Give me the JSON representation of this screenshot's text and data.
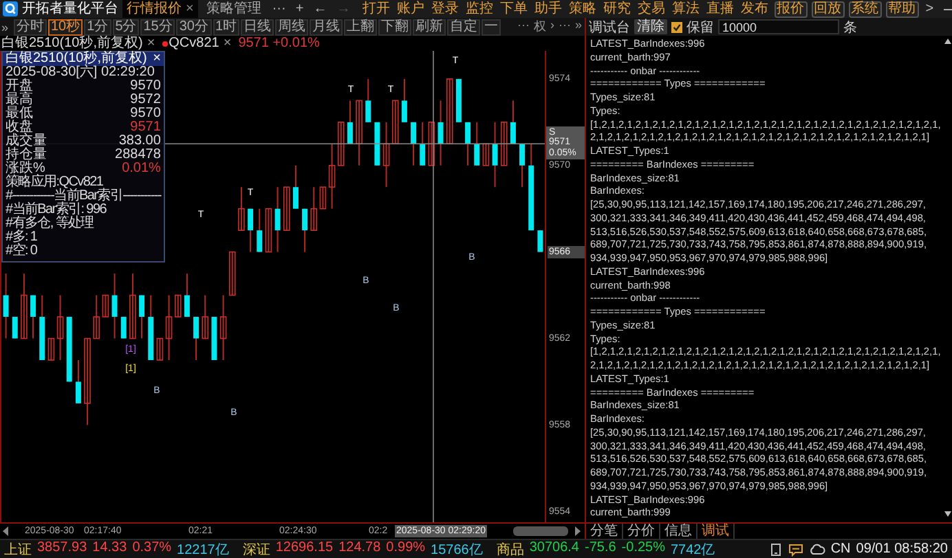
{
  "title_bar": {
    "app_name": "开拓者量化平台",
    "tabs": [
      {
        "label": "行情报价",
        "selected": true,
        "close_label": "×"
      },
      {
        "label": "策略管理",
        "selected": false
      }
    ],
    "tab_controls": [
      {
        "label": "···",
        "disabled": false
      },
      {
        "label": "+",
        "disabled": false
      },
      {
        "label": "←",
        "disabled": false
      },
      {
        "label": "→",
        "disabled": true
      }
    ],
    "menu": [
      "打开",
      "账户",
      "登录",
      "监控",
      "下单",
      "助手",
      "策略",
      "研究",
      "交易",
      "算法",
      "直播",
      "发布"
    ],
    "menu_buttons": [
      "报价",
      "回放",
      "系统",
      "帮助"
    ],
    "more": ">"
  },
  "chart": {
    "toolbar": {
      "expand": "»",
      "periods": [
        {
          "label": "分时",
          "selected": false
        },
        {
          "label": "10秒",
          "selected": true
        },
        {
          "label": "1分",
          "selected": false
        },
        {
          "label": "5分",
          "selected": false
        },
        {
          "label": "15分",
          "selected": false
        },
        {
          "label": "30分",
          "selected": false
        },
        {
          "label": "1时",
          "selected": false
        },
        {
          "label": "日线",
          "selected": false
        },
        {
          "label": "周线",
          "selected": false
        },
        {
          "label": "月线",
          "selected": false
        }
      ],
      "actions": [
        "上翻",
        "下翻",
        "刷新",
        "自定",
        "一"
      ],
      "right": [
        "···",
        "权",
        "›",
        "···",
        "»"
      ]
    },
    "tabs": [
      {
        "kind": "symbol",
        "label": "白银2510(10秒,前复权)",
        "close_label": "×"
      },
      {
        "kind": "strategy",
        "label": "QCv821",
        "close_label": "×"
      },
      {
        "kind": "quote",
        "label": "9571 +0.01%",
        "rising": true
      }
    ],
    "info": {
      "title": "白银2510(10秒,前复权)",
      "close_label": "×",
      "datetime": "2025-08-30[六] 02:29:20",
      "fields": [
        {
          "label": "开盘",
          "value": "9570",
          "rising": false
        },
        {
          "label": "最高",
          "value": "9572",
          "rising": false
        },
        {
          "label": "最低",
          "value": "9570",
          "rising": false
        },
        {
          "label": "收盘",
          "value": "9571",
          "rising": true
        },
        {
          "label": "成交量",
          "value": "383.00",
          "rising": false
        },
        {
          "label": "持仓量",
          "value": "288478",
          "rising": false
        },
        {
          "label": "涨跌%",
          "value": "0.01%",
          "rising": true
        }
      ],
      "notes": [
        "策略应用:QCv821",
        "#------------当前Bar索引-----------",
        "#当前Bar索引: 996",
        "#有多仓, 等处理",
        "#多: 1",
        "#空: 0"
      ]
    },
    "markers": [
      {
        "label": "T",
        "kind": "top"
      },
      {
        "label": "T",
        "kind": "top"
      },
      {
        "label": "T",
        "kind": "top"
      },
      {
        "label": "T",
        "kind": "top"
      },
      {
        "label": "T",
        "kind": "top"
      },
      {
        "label": "B",
        "kind": "bottom"
      },
      {
        "label": "B",
        "kind": "bottom"
      },
      {
        "label": "B",
        "kind": "bottom"
      },
      {
        "label": "B",
        "kind": "bottom"
      },
      {
        "label": "B",
        "kind": "bottom"
      },
      {
        "label": "[1]",
        "kind": "entry"
      },
      {
        "label": "[1]",
        "kind": "exit"
      }
    ],
    "price_axis": [
      {
        "highlighted": false
      },
      {
        "highlighted": false
      },
      {
        "highlighted": true
      },
      {
        "highlighted": false
      },
      {
        "highlighted": false
      },
      {
        "highlighted": false
      }
    ],
    "price_tag": {
      "side": "S",
      "price": "9571",
      "change": "0.05%"
    },
    "time_axis": {
      "labels": [
        "2025-08-30",
        "02:17:40",
        "02:21",
        "02:24:30",
        "02:2"
      ],
      "cursor": "2025-08-30 02:29:20"
    },
    "chart_data": {
      "type": "candlestick",
      "ylim": [
        9553.5,
        9575.3
      ],
      "yticks": [
        {
          "value": 9574,
          "label": "9574"
        },
        {
          "value": 9570,
          "label": "9570"
        },
        {
          "value": 9566,
          "label": "9566"
        },
        {
          "value": 9562,
          "label": "9562"
        },
        {
          "value": 9558,
          "label": "9558"
        },
        {
          "value": 9554,
          "label": "9554"
        }
      ],
      "categories": [
        null,
        null,
        null,
        null,
        null,
        null,
        null,
        null,
        null,
        null,
        null,
        null,
        null,
        null,
        null,
        null,
        null,
        null,
        null,
        null,
        null,
        null,
        null,
        null,
        null,
        null,
        null,
        null,
        null,
        null,
        null,
        null,
        null,
        null,
        null,
        null,
        null,
        null,
        null,
        null,
        null,
        null,
        null,
        null,
        null,
        null,
        null,
        null,
        null,
        null,
        null,
        null,
        null,
        null,
        null,
        null,
        null,
        null,
        null,
        null
      ],
      "ohlc": [
        [
          9564,
          9565,
          9562,
          9563
        ],
        [
          9563,
          9563,
          9562,
          9562
        ],
        [
          9562,
          9565,
          9562,
          9564
        ],
        [
          9564,
          9564,
          9562,
          9563
        ],
        [
          9563,
          9564,
          9561,
          9561
        ],
        [
          9561,
          9562,
          9561,
          9562
        ],
        [
          9562,
          9564,
          9561,
          9563
        ],
        [
          9563,
          9563,
          9560,
          9560
        ],
        [
          9560,
          9561,
          9559,
          9559
        ],
        [
          9559,
          9562,
          9558,
          9562
        ],
        [
          9562,
          9564,
          9562,
          9563
        ],
        [
          9563,
          9564,
          9563,
          9564
        ],
        [
          9564,
          9565,
          9562,
          9563
        ],
        [
          9563,
          9563,
          9562,
          9562
        ],
        [
          9562,
          9565,
          9562,
          9564
        ],
        [
          9564,
          9564,
          9562,
          9563
        ],
        [
          9563,
          9564,
          9561,
          9561
        ],
        [
          9561,
          9562,
          9561,
          9562
        ],
        [
          9562,
          9564,
          9561,
          9563
        ],
        [
          9563,
          9564,
          9563,
          9564
        ],
        [
          9564,
          9565,
          9563,
          9563
        ],
        [
          9563,
          9563,
          9561,
          9562
        ],
        [
          9562,
          9564,
          9562,
          9563
        ],
        [
          9563,
          9563,
          9561,
          9561
        ],
        [
          9562,
          9564,
          9561,
          9563
        ],
        [
          9564,
          9566,
          9564,
          9566
        ],
        [
          9567,
          9569,
          9567,
          9568
        ],
        [
          9568,
          9568,
          9566,
          9567
        ],
        [
          9567,
          9568,
          9566,
          9566
        ],
        [
          9566,
          9568,
          9566,
          9568
        ],
        [
          9568,
          9569,
          9566,
          9567
        ],
        [
          9567,
          9569,
          9567,
          9569
        ],
        [
          9569,
          9570,
          9568,
          9568
        ],
        [
          9568,
          9568,
          9566,
          9567
        ],
        [
          9567,
          9569,
          9567,
          9568
        ],
        [
          9568,
          9569,
          9568,
          9569
        ],
        [
          9569,
          9571,
          9568,
          9570
        ],
        [
          9570,
          9572,
          9570,
          9572
        ],
        [
          9572,
          9573,
          9571,
          9571
        ],
        [
          9571,
          9573,
          9570,
          9573
        ],
        [
          9573,
          9574,
          9572,
          9572
        ],
        [
          9572,
          9572,
          9570,
          9570
        ],
        [
          9570,
          9572,
          9569,
          9571
        ],
        [
          9571,
          9573,
          9571,
          9573
        ],
        [
          9573,
          9574,
          9572,
          9572
        ],
        [
          9572,
          9572,
          9570,
          9571
        ],
        [
          9571,
          9572,
          9570,
          9570
        ],
        [
          9570,
          9572,
          9570,
          9572
        ],
        [
          9572,
          9573,
          9570,
          9571
        ],
        [
          9571,
          9574,
          9571,
          9574
        ],
        [
          9574,
          9574,
          9572,
          9572
        ],
        [
          9572,
          9572,
          9570,
          9571
        ],
        [
          9571,
          9572,
          9570,
          9570
        ],
        [
          9570,
          9571,
          9570,
          9571
        ],
        [
          9571,
          9572,
          9569,
          9570
        ],
        [
          9570,
          9572,
          9570,
          9572
        ],
        [
          9572,
          9573,
          9571,
          9571
        ],
        [
          9571,
          9571,
          9569,
          9570
        ],
        [
          9570,
          9571,
          9567,
          9567
        ],
        [
          9567,
          9567,
          9566,
          9566
        ]
      ]
    }
  },
  "console": {
    "title": "调试台",
    "clear": "清除",
    "keep_checked": true,
    "keep_label": "保留",
    "keep_value": "10000",
    "unit": "条",
    "lines": [
      "LATEST_BarIndexes:996",
      "current_barth:997",
      "----------- onbar ------------",
      "============ Types ============",
      "Types_size:81",
      "Types:",
      "[1,2,1,2,1,2,1,2,1,2,1,2,1,2,1,2,1,2,1,2,1,2,1,2,1,2,1,2,1,2,1,2,1,2,1,2,1,2,1,2,1,",
      "2,1,2,1,2,1,2,1,2,1,2,1,2,1,2,1,2,1,2,1,2,1,2,1,2,1,2,1,2,1,2,1,2,1,2,1,2,1,2,1]",
      "LATEST_Types:1",
      "========= BarIndexes =========",
      "BarIndexes_size:81",
      "BarIndexes:",
      "[25,30,90,95,113,121,142,157,169,174,180,195,206,217,246,271,286,297,",
      "300,321,333,341,346,349,411,420,430,436,441,452,459,468,474,494,498,",
      "513,516,526,530,537,548,552,575,609,613,618,640,658,668,673,678,685,",
      "689,707,721,725,730,733,743,758,795,853,861,874,878,888,894,900,919,",
      "934,939,947,950,953,967,970,974,979,985,988,996]",
      "LATEST_BarIndexes:996",
      "current_barth:998",
      "----------- onbar ------------",
      "============ Types ============",
      "Types_size:81",
      "Types:",
      "[1,2,1,2,1,2,1,2,1,2,1,2,1,2,1,2,1,2,1,2,1,2,1,2,1,2,1,2,1,2,1,2,1,2,1,2,1,2,1,2,1,",
      "2,1,2,1,2,1,2,1,2,1,2,1,2,1,2,1,2,1,2,1,2,1,2,1,2,1,2,1,2,1,2,1,2,1,2,1,2,1,2,1]",
      "LATEST_Types:1",
      "========= BarIndexes =========",
      "BarIndexes_size:81",
      "BarIndexes:",
      "[25,30,90,95,113,121,142,157,169,174,180,195,206,217,246,271,286,297,",
      "300,321,333,341,346,349,411,420,430,436,441,452,459,468,474,494,498,",
      "513,516,526,530,537,548,552,575,609,613,618,640,658,668,673,678,685,",
      "689,707,721,725,730,733,743,758,795,853,861,874,878,888,894,900,919,",
      "934,939,947,950,953,967,970,974,979,985,988,996]",
      "LATEST_BarIndexes:996",
      "current_barth:999"
    ],
    "tabs": [
      {
        "label": "分笔",
        "selected": false
      },
      {
        "label": "分价",
        "selected": false
      },
      {
        "label": "信息",
        "selected": false
      },
      {
        "label": "调试",
        "selected": true
      }
    ]
  },
  "status_bar": {
    "indices": [
      {
        "name": "上证",
        "value": "3857.93",
        "change": "14.33",
        "percent": "0.37%",
        "amount": "12217亿",
        "rising": true
      },
      {
        "name": "深证",
        "value": "12696.15",
        "change": "124.78",
        "percent": "0.99%",
        "amount": "15766亿",
        "rising": true
      },
      {
        "name": "商品",
        "value": "30706.4",
        "change": "-75.6",
        "percent": "-0.25%",
        "amount": "7742亿",
        "rising": false
      }
    ],
    "locale": "CN",
    "datetime": "09/01 08:58:20"
  }
}
